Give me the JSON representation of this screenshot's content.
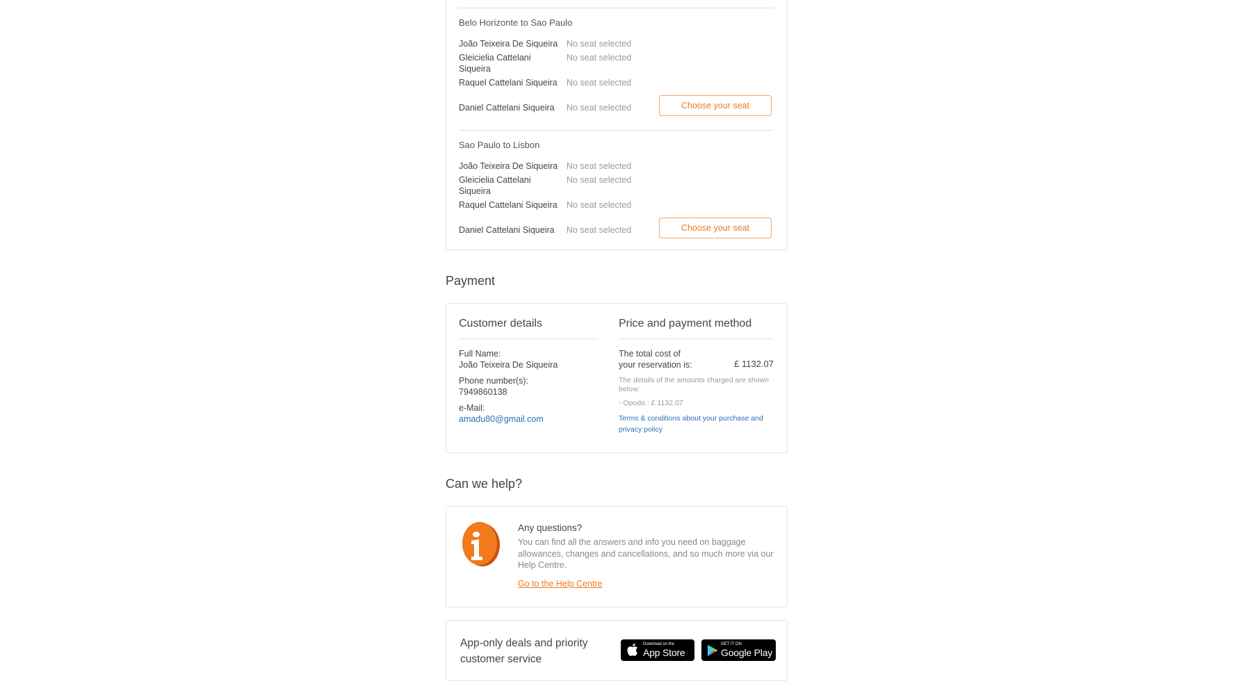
{
  "seats": {
    "legs": [
      {
        "title": "Belo Horizonte to Sao Paulo",
        "passengers": [
          {
            "name": "João Teixeira De Siqueira",
            "seat": "No seat selected"
          },
          {
            "name": "Gleicielia Cattelani Siqueira",
            "seat": "No seat selected"
          },
          {
            "name": "Raquel Cattelani Siqueira",
            "seat": "No seat selected"
          },
          {
            "name": "Daniel Cattelani Siqueira",
            "seat": "No seat selected"
          }
        ],
        "button_label": "Choose your seat"
      },
      {
        "title": "Sao Paulo to Lisbon",
        "passengers": [
          {
            "name": "João Teixeira De Siqueira",
            "seat": "No seat selected"
          },
          {
            "name": "Gleicielia Cattelani Siqueira",
            "seat": "No seat selected"
          },
          {
            "name": "Raquel Cattelani Siqueira",
            "seat": "No seat selected"
          },
          {
            "name": "Daniel Cattelani Siqueira",
            "seat": "No seat selected"
          }
        ],
        "button_label": "Choose your seat"
      }
    ]
  },
  "payment": {
    "heading": "Payment",
    "customer": {
      "title": "Customer details",
      "full_name_label": "Full Name:",
      "full_name": "João Teixeira De Siqueira",
      "phone_label": "Phone number(s):",
      "phone": "7949860138",
      "email_label": "e-Mail:",
      "email": "amadu80@gmail.com"
    },
    "price": {
      "title": "Price and payment method",
      "total_label_line1": "The total cost of",
      "total_label_line2": "your reservation is:",
      "total": "£ 1132.07",
      "details_note": "The details of the amounts charged are shown below:",
      "breakdown": "- Opodo : £ 1132.07",
      "terms_link": "Terms & conditions about your purchase and privacy policy"
    }
  },
  "help": {
    "heading": "Can we help?",
    "icon": "info-icon",
    "title": "Any questions?",
    "text": "You can find all the answers and info you need on baggage allowances, changes and cancellations, and so much more via our Help Centre.",
    "link": "Go to the Help Centre"
  },
  "app": {
    "text": "App-only deals and priority customer service",
    "app_store_small": "Download on the",
    "app_store_big": "App Store",
    "google_play_small": "GET IT ON",
    "google_play_big": "Google Play"
  },
  "colors": {
    "accent": "#ee7a1f",
    "link": "#2a6fb5",
    "border": "#e2e2e2"
  }
}
